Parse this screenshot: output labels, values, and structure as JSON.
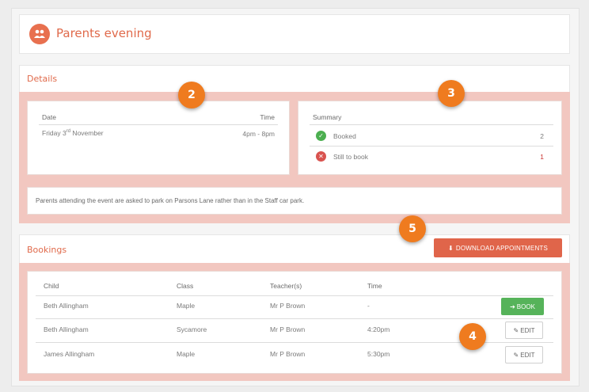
{
  "header": {
    "title": "Parents evening",
    "icon": "people-icon"
  },
  "details": {
    "title": "Details",
    "date_label": "Date",
    "time_label": "Time",
    "date_value": "Friday 3",
    "date_suffix": "rd",
    "date_month": " November",
    "time_value": "4pm - 8pm",
    "summary": {
      "title": "Summary",
      "items": [
        {
          "label": "Booked",
          "count": "2",
          "icon": "check-circle-icon",
          "color": "#4caf50"
        },
        {
          "label": "Still to book",
          "count": "1",
          "icon": "x-circle-icon",
          "color": "#d9534f"
        }
      ]
    },
    "note": "Parents attending the event are asked to park on Parsons Lane rather than in the Staff car park."
  },
  "bookings": {
    "title": "Bookings",
    "download_label": "DOWNLOAD APPOINTMENTS",
    "columns": [
      "Child",
      "Class",
      "Teacher(s)",
      "Time"
    ],
    "rows": [
      {
        "child": "Beth Allingham",
        "class": "Maple",
        "teacher": "Mr P Brown",
        "time": "-",
        "action": "BOOK"
      },
      {
        "child": "Beth Allingham",
        "class": "Sycamore",
        "teacher": "Mr P Brown",
        "time": "4:20pm",
        "action": "EDIT"
      },
      {
        "child": "James Allingham",
        "class": "Maple",
        "teacher": "Mr P Brown",
        "time": "5:30pm",
        "action": "EDIT"
      }
    ]
  },
  "badges": [
    "2",
    "3",
    "5",
    "4"
  ],
  "colors": {
    "accent": "#e06a4b",
    "badge": "#ef7b1f",
    "book": "#56b35a",
    "section_bg": "#f2c7c0"
  }
}
